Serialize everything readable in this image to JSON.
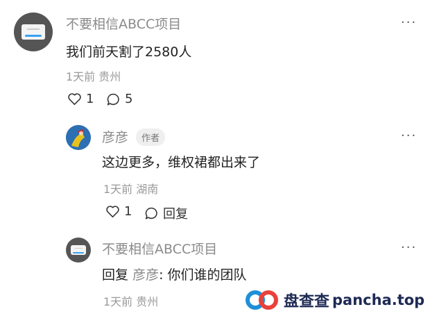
{
  "comments": [
    {
      "author": "不要相信ABCC项目",
      "text": "我们前天割了2580人",
      "meta": "1天前  贵州",
      "like_count": "1",
      "reply_count": "5"
    },
    {
      "author": "彦彦",
      "badge": "作者",
      "text": "这边更多，维权裙都出来了",
      "meta": "1天前  湖南",
      "like_count": "1",
      "reply_label": "回复"
    },
    {
      "author": "不要相信ABCC项目",
      "reply_prefix": "回复",
      "reply_target": "彦彦",
      "reply_text": ": 你们谁的团队",
      "meta": "1天前  贵州"
    }
  ],
  "more_label": "···",
  "watermark": {
    "cn": "盘查查",
    "en": "pancha.top"
  },
  "icons": {
    "like": "heart-outline-icon",
    "reply": "speech-bubble-icon",
    "more": "more-dots-icon"
  }
}
